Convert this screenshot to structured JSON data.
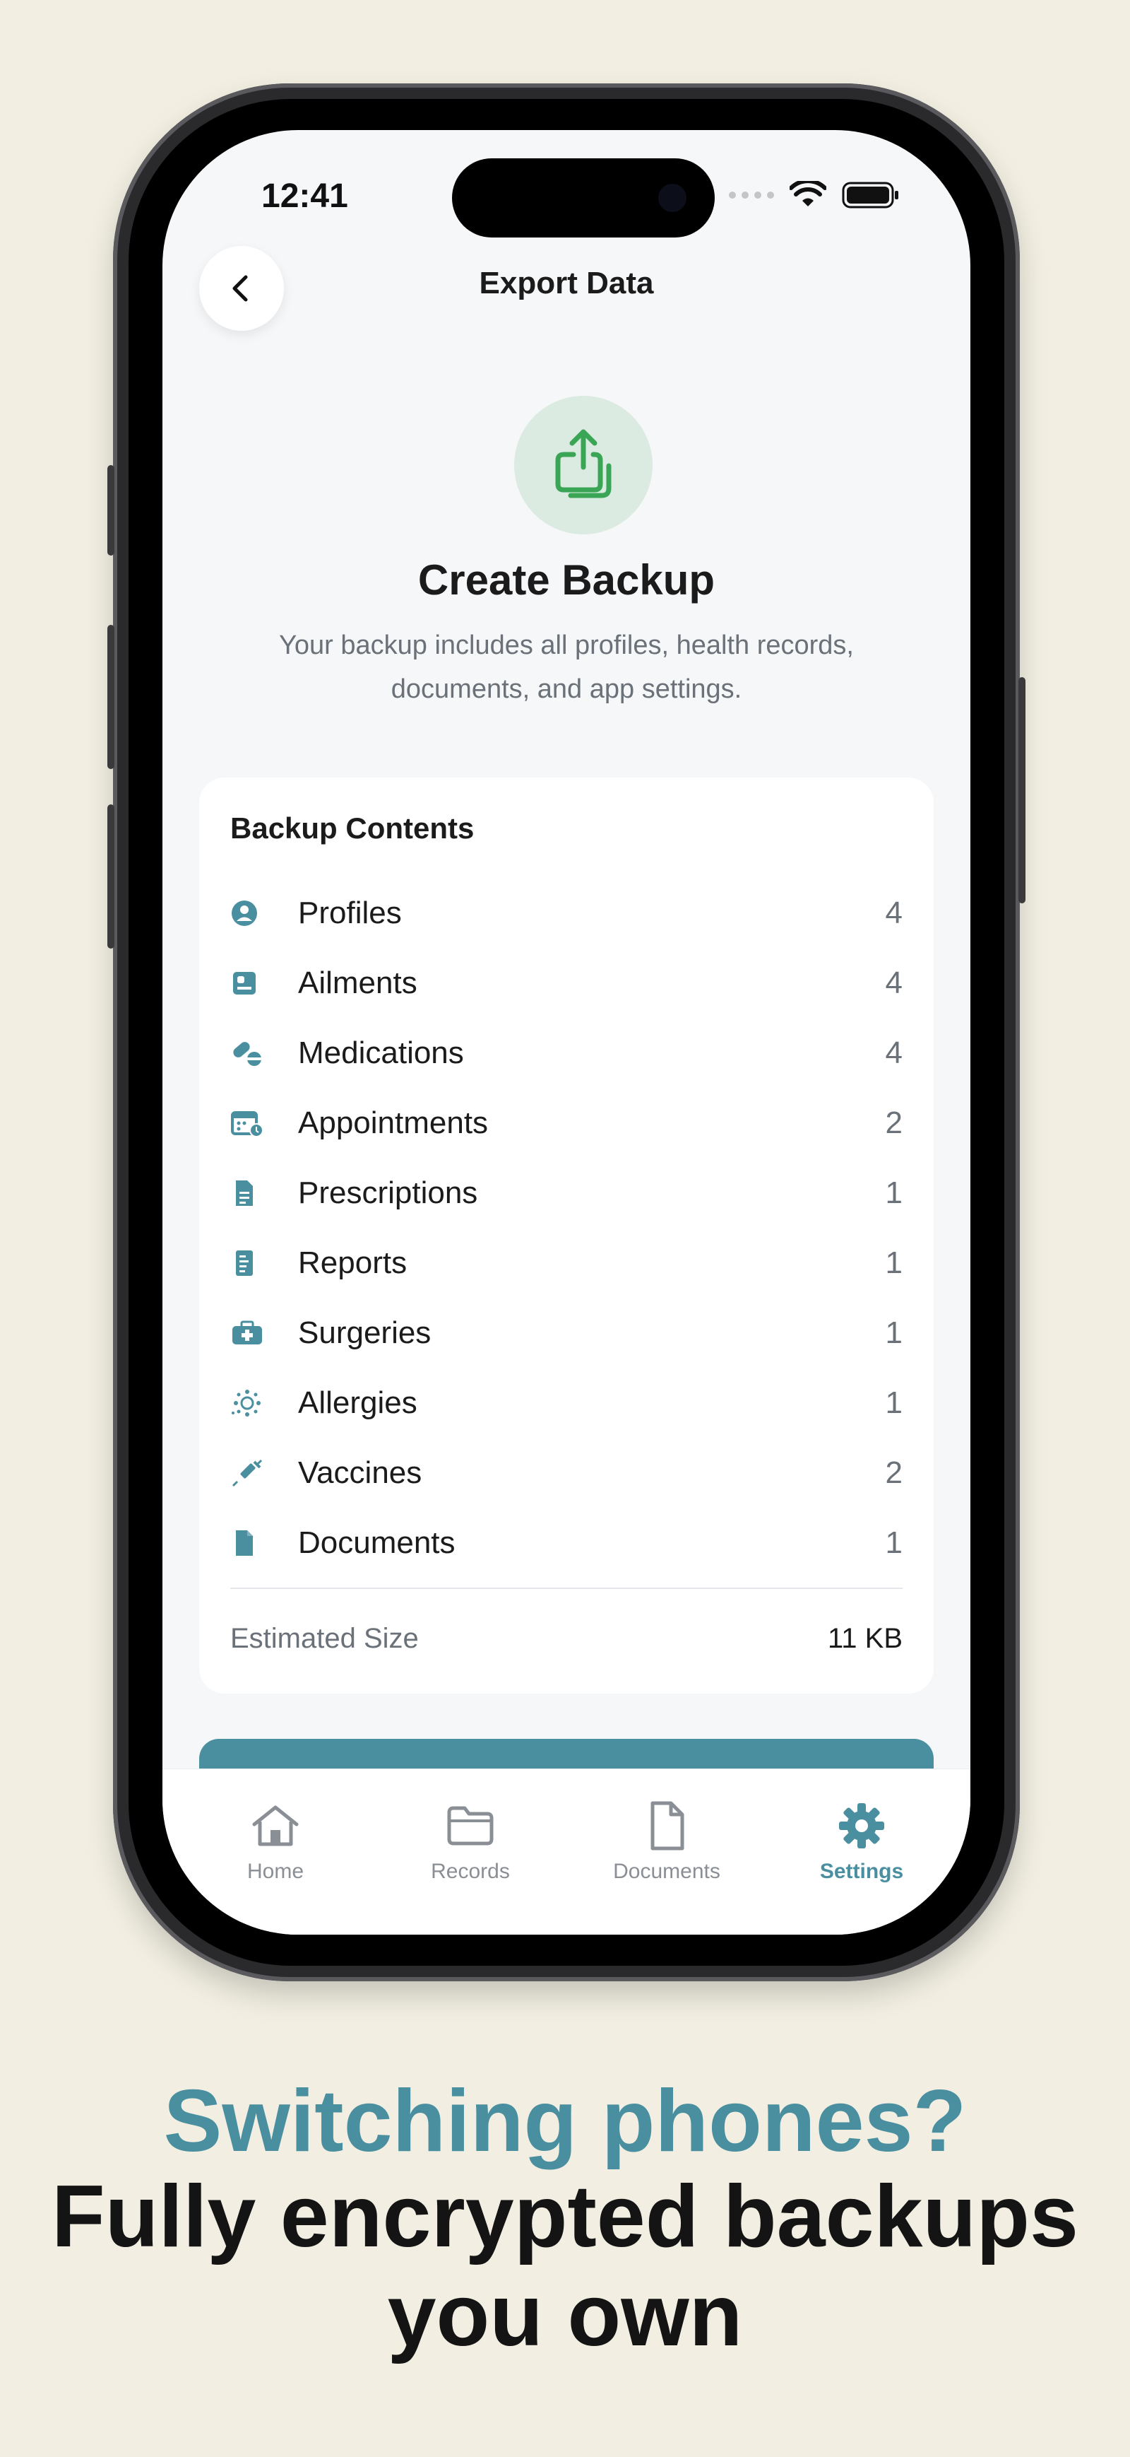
{
  "status_bar": {
    "time": "12:41"
  },
  "nav": {
    "title": "Export Data",
    "back_icon": "chevron-left-icon"
  },
  "hero": {
    "icon": "share-export-icon",
    "title": "Create Backup",
    "subtitle": "Your backup includes all profiles, health records, documents, and app settings."
  },
  "backup_contents": {
    "title": "Backup Contents",
    "items": [
      {
        "icon": "profile-icon",
        "label": "Profiles",
        "count": "4"
      },
      {
        "icon": "ailment-icon",
        "label": "Ailments",
        "count": "4"
      },
      {
        "icon": "pill-icon",
        "label": "Medications",
        "count": "4"
      },
      {
        "icon": "calendar-clock-icon",
        "label": "Appointments",
        "count": "2"
      },
      {
        "icon": "prescription-doc-icon",
        "label": "Prescriptions",
        "count": "1"
      },
      {
        "icon": "report-icon",
        "label": "Reports",
        "count": "1"
      },
      {
        "icon": "medical-kit-icon",
        "label": "Surgeries",
        "count": "1"
      },
      {
        "icon": "virus-icon",
        "label": "Allergies",
        "count": "1"
      },
      {
        "icon": "syringe-icon",
        "label": "Vaccines",
        "count": "2"
      },
      {
        "icon": "document-icon",
        "label": "Documents",
        "count": "1"
      }
    ],
    "estimated_size_label": "Estimated Size",
    "estimated_size_value": "11 KB"
  },
  "tabbar": {
    "tabs": [
      {
        "label": "Home",
        "icon": "home-icon",
        "active": false
      },
      {
        "label": "Records",
        "icon": "folder-icon",
        "active": false
      },
      {
        "label": "Documents",
        "icon": "file-icon",
        "active": false
      },
      {
        "label": "Settings",
        "icon": "gear-icon",
        "active": true
      }
    ]
  },
  "tagline": {
    "line1": "Switching phones?",
    "line2": "Fully encrypted backups you own"
  },
  "colors": {
    "accent": "#4a8fa0",
    "success_green": "#3aa655",
    "background": "#f2efe2"
  }
}
